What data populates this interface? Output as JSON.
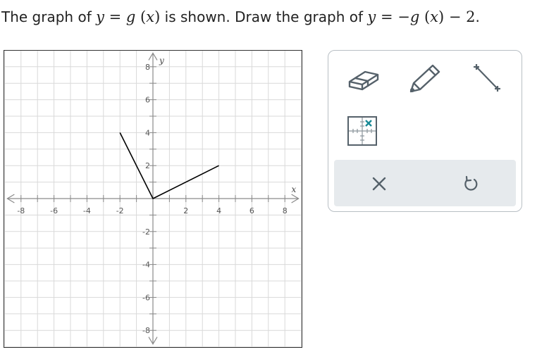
{
  "question": {
    "prefix": "The graph of",
    "given_function": "y = g (x)",
    "middle": "is shown. Draw the graph of",
    "target_function": "y = −g (x) − 2",
    "end": "."
  },
  "graph": {
    "x_axis_label": "x",
    "y_axis_label": "y",
    "x_tick_labels": [
      "-8",
      "-6",
      "-4",
      "-2",
      "2",
      "4",
      "6",
      "8"
    ],
    "y_tick_labels": [
      "8",
      "6",
      "4",
      "2",
      "-2",
      "-4",
      "-6",
      "-8"
    ],
    "xlim": [
      -9,
      9
    ],
    "ylim": [
      -9,
      9
    ],
    "grid": true,
    "line_color": "#000000",
    "grid_color": "#d9d9d9"
  },
  "chart_data": {
    "type": "line",
    "title": "",
    "xlabel": "x",
    "ylabel": "y",
    "xlim": [
      -9,
      9
    ],
    "ylim": [
      -9,
      9
    ],
    "grid": true,
    "series": [
      {
        "x": [
          -2,
          0,
          4
        ],
        "y": [
          4,
          0,
          2
        ]
      }
    ]
  },
  "toolbox": {
    "tools": [
      "eraser-icon",
      "pencil-icon",
      "line-segment-icon",
      "point-grid-icon"
    ],
    "actions": [
      "clear-x-icon",
      "undo-icon"
    ],
    "accent_color": "#1a8a96",
    "icon_color": "#55616a"
  }
}
